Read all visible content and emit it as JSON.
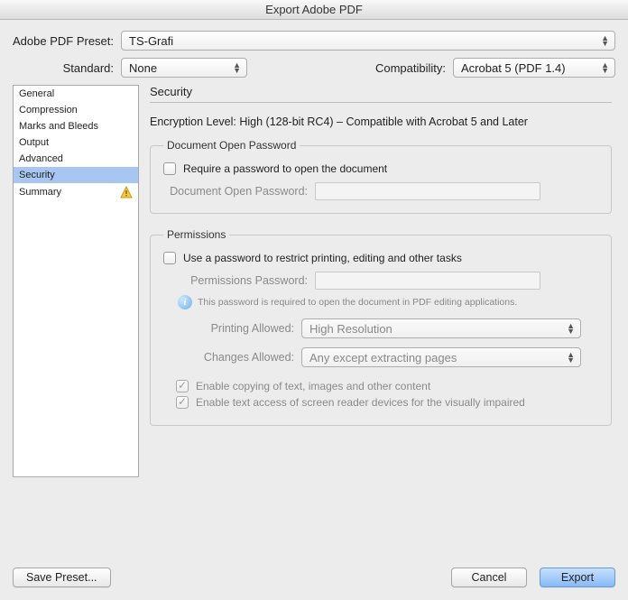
{
  "window": {
    "title": "Export Adobe PDF"
  },
  "preset": {
    "label": "Adobe PDF Preset:",
    "value": "TS-Grafi"
  },
  "standard": {
    "label": "Standard:",
    "value": "None"
  },
  "compatibility": {
    "label": "Compatibility:",
    "value": "Acrobat 5 (PDF 1.4)"
  },
  "sidebar": {
    "items": [
      {
        "label": "General"
      },
      {
        "label": "Compression"
      },
      {
        "label": "Marks and Bleeds"
      },
      {
        "label": "Output"
      },
      {
        "label": "Advanced"
      },
      {
        "label": "Security"
      },
      {
        "label": "Summary"
      }
    ]
  },
  "panel": {
    "title": "Security",
    "encryption_line": "Encryption Level: High (128-bit RC4) – Compatible with Acrobat 5 and Later",
    "doc_open": {
      "legend": "Document Open Password",
      "require_label": "Require a password to open the document",
      "pwd_label": "Document Open Password:"
    },
    "permissions": {
      "legend": "Permissions",
      "use_label": "Use a password to restrict printing, editing and other tasks",
      "pwd_label": "Permissions Password:",
      "info_text": "This password is required to open the document in PDF editing applications.",
      "printing_label": "Printing Allowed:",
      "printing_value": "High Resolution",
      "changes_label": "Changes Allowed:",
      "changes_value": "Any except extracting pages",
      "copy_label": "Enable copying of text, images and other content",
      "access_label": "Enable text access of screen reader devices for the visually impaired"
    }
  },
  "footer": {
    "save_preset": "Save Preset...",
    "cancel": "Cancel",
    "export": "Export"
  }
}
